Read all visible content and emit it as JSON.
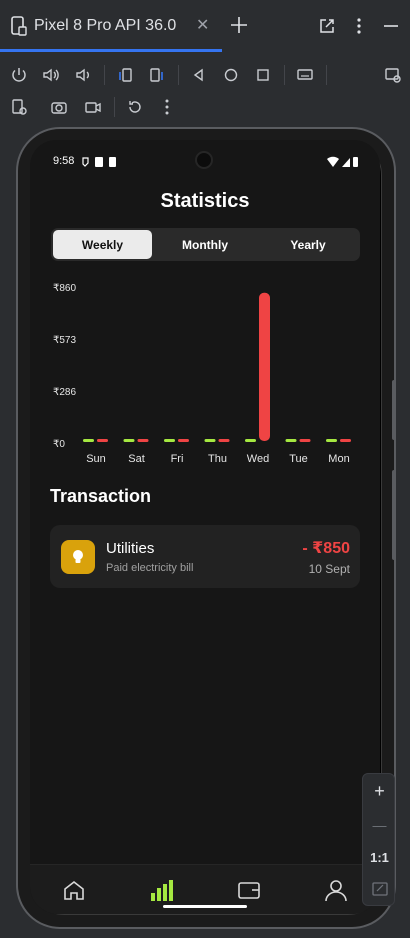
{
  "ide": {
    "tab_title": "Pixel 8 Pro API 36.0",
    "toolbar_icons": [
      "power-icon",
      "volume-up-icon",
      "volume-down-icon",
      "rotate-left-icon",
      "rotate-right-icon",
      "back-icon",
      "home-icon",
      "overview-icon",
      "keyboard-icon",
      "snapshot-icon",
      "settings-icon",
      "camera-icon",
      "record-icon",
      "reset-icon",
      "more-icon"
    ]
  },
  "status_bar": {
    "time": "9:58"
  },
  "app": {
    "title": "Statistics",
    "tabs": [
      {
        "label": "Weekly",
        "active": true
      },
      {
        "label": "Monthly",
        "active": false
      },
      {
        "label": "Yearly",
        "active": false
      }
    ],
    "section_title": "Transaction",
    "transaction": {
      "name": "Utilities",
      "description": "Paid electricity bill",
      "amount": "- ₹850",
      "date": "10 Sept",
      "icon": "lightbulb-icon"
    },
    "nav": [
      "home-icon",
      "stats-icon",
      "wallet-icon",
      "profile-icon"
    ],
    "accent_color": "#a5e841",
    "expense_color": "#ef4444"
  },
  "chart_data": {
    "type": "bar",
    "categories": [
      "Sun",
      "Sat",
      "Fri",
      "Thu",
      "Wed",
      "Tue",
      "Mon"
    ],
    "series": [
      {
        "values": [
          0,
          0,
          0,
          0,
          0,
          0,
          0
        ],
        "color": "#a5e841"
      },
      {
        "values": [
          0,
          0,
          0,
          0,
          850,
          0,
          0
        ],
        "color": "#ef4444"
      }
    ],
    "y_ticks": [
      "₹860",
      "₹573",
      "₹286",
      "₹0"
    ],
    "ylim": [
      0,
      860
    ]
  },
  "zoom_panel": {
    "plus": "+",
    "minus": "—",
    "ratio": "1:1"
  }
}
